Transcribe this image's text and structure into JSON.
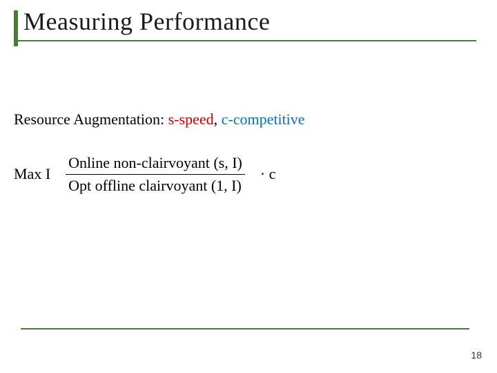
{
  "title": "Measuring Performance",
  "body": {
    "lead": "Resource Augmentation: ",
    "s_speed": "s-speed",
    "sep": ", ",
    "c_comp": "c-competitive"
  },
  "formula": {
    "max": "Max I",
    "numerator": "Online non-clairvoyant (s, I)",
    "denominator": "Opt offline clairvoyant (1, I)",
    "tail": "· c"
  },
  "page": "18"
}
